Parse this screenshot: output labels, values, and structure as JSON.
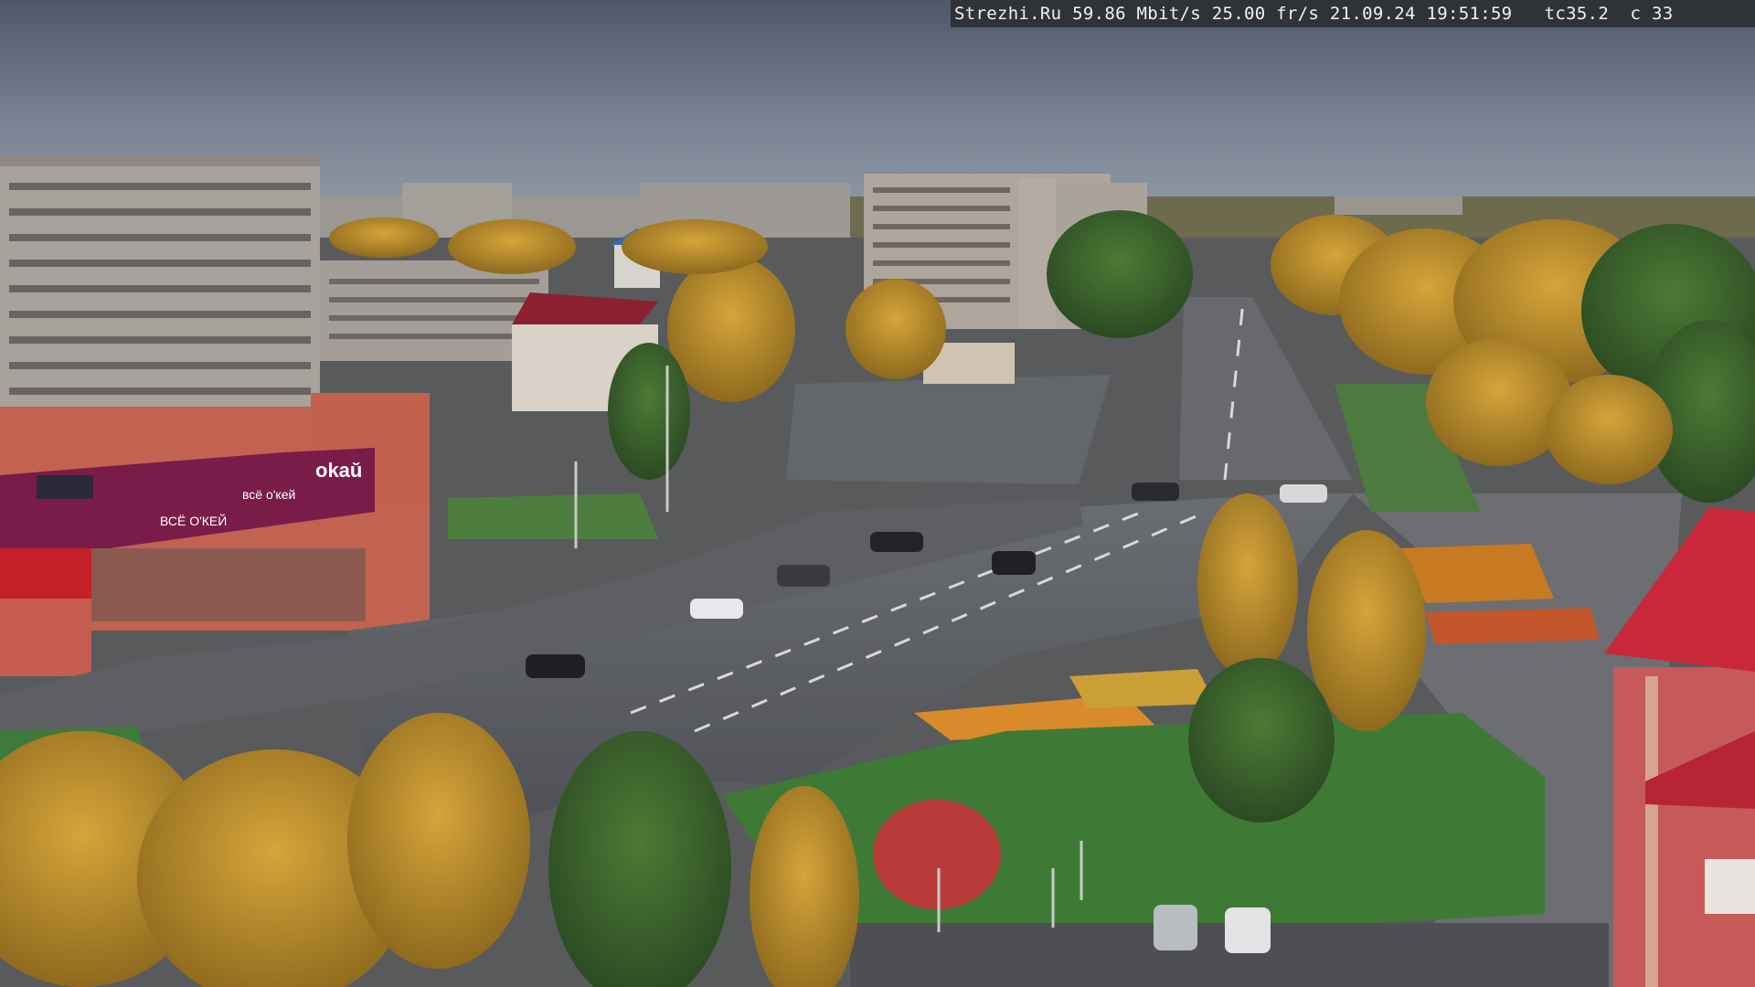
{
  "camera_feed": {
    "osd_text": "Strezhi.Ru 59.86 Mbit/s 25.00 fr/s 21.09.24 19:51:59   tc35.2  c 33"
  },
  "signage": {
    "store_sign_1": "okaŭ",
    "store_sign_2": "всё о'кей",
    "store_sign_3": "ВСЁ О'КЕЙ"
  },
  "colors": {
    "sky": "#6c7686",
    "road": "#5a5c60",
    "grass": "#3f7a3a",
    "autumn_tree": "#b98a2a",
    "building_panel": "#a9a4a0",
    "store_accent": "#7a1c4a",
    "roof_red": "#c4283a"
  }
}
